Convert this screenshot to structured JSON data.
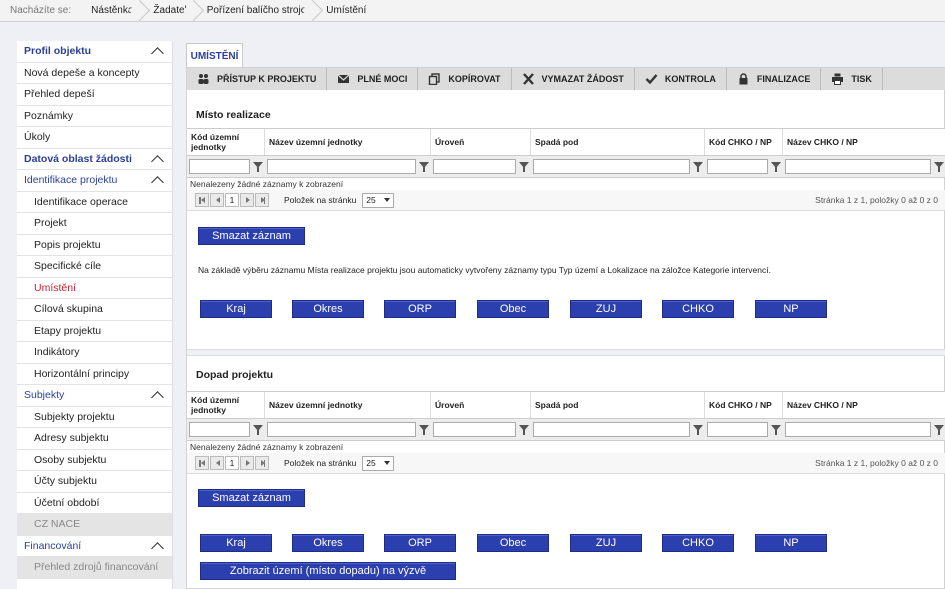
{
  "breadcrumb": {
    "lead": "Nacházíte se:",
    "items": [
      "Nástěnka",
      "Žadatel",
      "Pořízení balíčho stroje",
      "Umístění"
    ]
  },
  "sidebar": {
    "items": [
      {
        "label": "Profil objektu",
        "type": "head",
        "chevron": true
      },
      {
        "label": "Nová depeše a koncepty",
        "type": "plain"
      },
      {
        "label": "Přehled depeší",
        "type": "plain"
      },
      {
        "label": "Poznámky",
        "type": "plain"
      },
      {
        "label": "Úkoly",
        "type": "plain"
      },
      {
        "label": "Datová oblast žádosti",
        "type": "head",
        "chevron": true
      },
      {
        "label": "Identifikace projektu",
        "type": "head2",
        "chevron": true
      },
      {
        "label": "Identifikace operace",
        "type": "sub"
      },
      {
        "label": "Projekt",
        "type": "sub"
      },
      {
        "label": "Popis projektu",
        "type": "sub"
      },
      {
        "label": "Specifické cíle",
        "type": "sub"
      },
      {
        "label": "Umístění",
        "type": "sub active"
      },
      {
        "label": "Cílová skupina",
        "type": "sub"
      },
      {
        "label": "Etapy projektu",
        "type": "sub"
      },
      {
        "label": "Indikátory",
        "type": "sub"
      },
      {
        "label": "Horizontální principy",
        "type": "sub"
      },
      {
        "label": "Subjekty",
        "type": "head2",
        "chevron": true
      },
      {
        "label": "Subjekty projektu",
        "type": "sub"
      },
      {
        "label": "Adresy subjektu",
        "type": "sub"
      },
      {
        "label": "Osoby subjektu",
        "type": "sub"
      },
      {
        "label": "Účty subjektu",
        "type": "sub"
      },
      {
        "label": "Účetní období",
        "type": "sub"
      },
      {
        "label": "CZ NACE",
        "type": "sub disabled"
      },
      {
        "label": "Financování",
        "type": "head2",
        "chevron": true
      },
      {
        "label": "Přehled zdrojů financování",
        "type": "sub disabled"
      }
    ]
  },
  "tab": {
    "label": "UMÍSTĚNÍ"
  },
  "toolbar": {
    "buttons": [
      {
        "label": "PŘÍSTUP K PROJEKTU",
        "icon": "people-icon"
      },
      {
        "label": "PLNÉ MOCI",
        "icon": "mail-icon"
      },
      {
        "label": "KOPÍROVAT",
        "icon": "copy-icon"
      },
      {
        "label": "VYMAZAT ŽÁDOST",
        "icon": "x-icon"
      },
      {
        "label": "KONTROLA",
        "icon": "check-icon"
      },
      {
        "label": "FINALIZACE",
        "icon": "lock-icon"
      },
      {
        "label": "TISK",
        "icon": "printer-icon"
      }
    ]
  },
  "section1": {
    "title": "Místo realizace",
    "columns": [
      "Kód územní jednotky",
      "Název územní jednotky",
      "Úroveň",
      "Spadá pod",
      "Kód CHKO / NP",
      "Název CHKO / NP"
    ],
    "empty": "Nenalezeny žádné záznamy k zobrazení",
    "page": "1",
    "per_page_label": "Položek na stránku",
    "per_page": "25",
    "page_info": "Stránka 1 z 1, položky 0 až 0 z 0",
    "delete": "Smazat záznam",
    "note": "Na základě výběru záznamu Místa realizace projektu jsou automaticky vytvořeny záznamy typu Typ území a Lokalizace na záložce Kategorie intervencí.",
    "level_buttons": [
      "Kraj",
      "Okres",
      "ORP",
      "Obec",
      "ZUJ",
      "CHKO",
      "NP"
    ]
  },
  "section2": {
    "title": "Dopad projektu",
    "columns": [
      "Kód územní jednotky",
      "Název územní jednotky",
      "Úroveň",
      "Spadá pod",
      "Kód CHKO / NP",
      "Název CHKO / NP"
    ],
    "empty": "Nenalezeny žádné záznamy k zobrazení",
    "page": "1",
    "per_page_label": "Položek na stránku",
    "per_page": "25",
    "page_info": "Stránka 1 z 1, položky 0 až 0 z 0",
    "delete": "Smazat záznam",
    "level_buttons": [
      "Kraj",
      "Okres",
      "ORP",
      "Obec",
      "ZUJ",
      "CHKO",
      "NP"
    ],
    "show_button": "Zobrazit území (místo dopadu) na výzvě"
  },
  "colors": {
    "brand_blue": "#2b3fae",
    "active_red": "#cc1f2e",
    "heading_blue": "#2a3f9a"
  }
}
